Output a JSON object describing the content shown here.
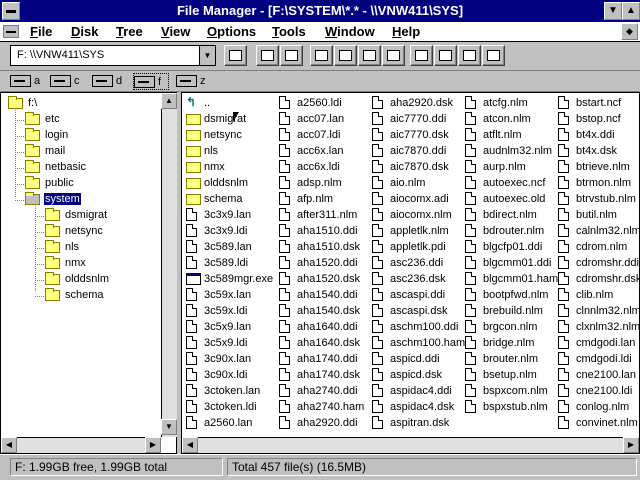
{
  "window": {
    "title": "File Manager - [F:\\SYSTEM\\*.* - \\\\VNW411\\SYS]"
  },
  "menubar": {
    "items": [
      "File",
      "Disk",
      "Tree",
      "View",
      "Options",
      "Tools",
      "Window",
      "Help"
    ]
  },
  "toolbar": {
    "drive_select_value": "F: \\\\VNW411\\SYS"
  },
  "drives": [
    {
      "letter": "a",
      "selected": false
    },
    {
      "letter": "c",
      "selected": false
    },
    {
      "letter": "d",
      "selected": false
    },
    {
      "letter": "f",
      "selected": true
    },
    {
      "letter": "z",
      "selected": false
    }
  ],
  "tree": {
    "root": "f:\\",
    "nodes": [
      {
        "label": "etc",
        "level": 1
      },
      {
        "label": "login",
        "level": 1
      },
      {
        "label": "mail",
        "level": 1
      },
      {
        "label": "netbasic",
        "level": 1
      },
      {
        "label": "public",
        "level": 1
      },
      {
        "label": "system",
        "level": 1,
        "selected": true
      },
      {
        "label": "dsmigrat",
        "level": 2
      },
      {
        "label": "netsync",
        "level": 2
      },
      {
        "label": "nls",
        "level": 2
      },
      {
        "label": "nmx",
        "level": 2
      },
      {
        "label": "olddsnlm",
        "level": 2
      },
      {
        "label": "schema",
        "level": 2
      }
    ]
  },
  "files": {
    "columns": [
      [
        {
          "name": "..",
          "icon": "up"
        },
        {
          "name": "dsmigrat",
          "icon": "folder"
        },
        {
          "name": "netsync",
          "icon": "folder"
        },
        {
          "name": "nls",
          "icon": "folder"
        },
        {
          "name": "nmx",
          "icon": "folder"
        },
        {
          "name": "olddsnlm",
          "icon": "folder"
        },
        {
          "name": "schema",
          "icon": "folder"
        },
        {
          "name": "3c3x9.lan",
          "icon": "doc"
        },
        {
          "name": "3c3x9.ldi",
          "icon": "doc"
        },
        {
          "name": "3c589.lan",
          "icon": "doc"
        },
        {
          "name": "3c589.ldi",
          "icon": "doc"
        },
        {
          "name": "3c589mgr.exe",
          "icon": "exe"
        },
        {
          "name": "3c59x.lan",
          "icon": "doc"
        },
        {
          "name": "3c59x.ldi",
          "icon": "doc"
        },
        {
          "name": "3c5x9.lan",
          "icon": "doc"
        },
        {
          "name": "3c5x9.ldi",
          "icon": "doc"
        },
        {
          "name": "3c90x.lan",
          "icon": "doc"
        },
        {
          "name": "3c90x.ldi",
          "icon": "doc"
        },
        {
          "name": "3ctoken.lan",
          "icon": "doc"
        },
        {
          "name": "3ctoken.ldi",
          "icon": "doc"
        },
        {
          "name": "a2560.lan",
          "icon": "doc"
        }
      ],
      [
        {
          "name": "a2560.ldi",
          "icon": "doc"
        },
        {
          "name": "acc07.lan",
          "icon": "doc"
        },
        {
          "name": "acc07.ldi",
          "icon": "doc"
        },
        {
          "name": "acc6x.lan",
          "icon": "doc"
        },
        {
          "name": "acc6x.ldi",
          "icon": "doc"
        },
        {
          "name": "adsp.nlm",
          "icon": "doc"
        },
        {
          "name": "afp.nlm",
          "icon": "doc"
        },
        {
          "name": "after311.nlm",
          "icon": "doc"
        },
        {
          "name": "aha1510.ddi",
          "icon": "doc"
        },
        {
          "name": "aha1510.dsk",
          "icon": "doc"
        },
        {
          "name": "aha1520.ddi",
          "icon": "doc"
        },
        {
          "name": "aha1520.dsk",
          "icon": "doc"
        },
        {
          "name": "aha1540.ddi",
          "icon": "doc"
        },
        {
          "name": "aha1540.dsk",
          "icon": "doc"
        },
        {
          "name": "aha1640.ddi",
          "icon": "doc"
        },
        {
          "name": "aha1640.dsk",
          "icon": "doc"
        },
        {
          "name": "aha1740.ddi",
          "icon": "doc"
        },
        {
          "name": "aha1740.dsk",
          "icon": "doc"
        },
        {
          "name": "aha2740.ddi",
          "icon": "doc"
        },
        {
          "name": "aha2740.ham",
          "icon": "doc"
        },
        {
          "name": "aha2920.ddi",
          "icon": "doc"
        }
      ],
      [
        {
          "name": "aha2920.dsk",
          "icon": "doc"
        },
        {
          "name": "aic7770.ddi",
          "icon": "doc"
        },
        {
          "name": "aic7770.dsk",
          "icon": "doc"
        },
        {
          "name": "aic7870.ddi",
          "icon": "doc"
        },
        {
          "name": "aic7870.dsk",
          "icon": "doc"
        },
        {
          "name": "aio.nlm",
          "icon": "doc"
        },
        {
          "name": "aiocomx.adi",
          "icon": "doc"
        },
        {
          "name": "aiocomx.nlm",
          "icon": "doc"
        },
        {
          "name": "appletlk.nlm",
          "icon": "doc"
        },
        {
          "name": "appletlk.pdi",
          "icon": "doc"
        },
        {
          "name": "asc236.ddi",
          "icon": "doc"
        },
        {
          "name": "asc236.dsk",
          "icon": "doc"
        },
        {
          "name": "ascaspi.ddi",
          "icon": "doc"
        },
        {
          "name": "ascaspi.dsk",
          "icon": "doc"
        },
        {
          "name": "aschm100.ddi",
          "icon": "doc"
        },
        {
          "name": "aschm100.ham",
          "icon": "doc"
        },
        {
          "name": "aspicd.ddi",
          "icon": "doc"
        },
        {
          "name": "aspicd.dsk",
          "icon": "doc"
        },
        {
          "name": "aspidac4.ddi",
          "icon": "doc"
        },
        {
          "name": "aspidac4.dsk",
          "icon": "doc"
        },
        {
          "name": "aspitran.dsk",
          "icon": "doc"
        }
      ],
      [
        {
          "name": "atcfg.nlm",
          "icon": "doc"
        },
        {
          "name": "atcon.nlm",
          "icon": "doc"
        },
        {
          "name": "atflt.nlm",
          "icon": "doc"
        },
        {
          "name": "audnlm32.nlm",
          "icon": "doc"
        },
        {
          "name": "aurp.nlm",
          "icon": "doc"
        },
        {
          "name": "autoexec.ncf",
          "icon": "doc"
        },
        {
          "name": "autoexec.old",
          "icon": "doc"
        },
        {
          "name": "bdirect.nlm",
          "icon": "doc"
        },
        {
          "name": "bdrouter.nlm",
          "icon": "doc"
        },
        {
          "name": "blgcfp01.ddi",
          "icon": "doc"
        },
        {
          "name": "blgcmm01.ddi",
          "icon": "doc"
        },
        {
          "name": "blgcmm01.ham",
          "icon": "doc"
        },
        {
          "name": "bootpfwd.nlm",
          "icon": "doc"
        },
        {
          "name": "brebuild.nlm",
          "icon": "doc"
        },
        {
          "name": "brgcon.nlm",
          "icon": "doc"
        },
        {
          "name": "bridge.nlm",
          "icon": "doc"
        },
        {
          "name": "brouter.nlm",
          "icon": "doc"
        },
        {
          "name": "bsetup.nlm",
          "icon": "doc"
        },
        {
          "name": "bspxcom.nlm",
          "icon": "doc"
        },
        {
          "name": "bspxstub.nlm",
          "icon": "doc"
        }
      ],
      [
        {
          "name": "bstart.ncf",
          "icon": "doc"
        },
        {
          "name": "bstop.ncf",
          "icon": "doc"
        },
        {
          "name": "bt4x.ddi",
          "icon": "doc"
        },
        {
          "name": "bt4x.dsk",
          "icon": "doc"
        },
        {
          "name": "btrieve.nlm",
          "icon": "doc"
        },
        {
          "name": "btrmon.nlm",
          "icon": "doc"
        },
        {
          "name": "btrvstub.nlm",
          "icon": "doc"
        },
        {
          "name": "butil.nlm",
          "icon": "doc"
        },
        {
          "name": "calnlm32.nlm",
          "icon": "doc"
        },
        {
          "name": "cdrom.nlm",
          "icon": "doc"
        },
        {
          "name": "cdromshr.ddi",
          "icon": "doc"
        },
        {
          "name": "cdromshr.dsk",
          "icon": "doc"
        },
        {
          "name": "clib.nlm",
          "icon": "doc"
        },
        {
          "name": "clnnlm32.nlm",
          "icon": "doc"
        },
        {
          "name": "clxnlm32.nlm",
          "icon": "doc"
        },
        {
          "name": "cmdgodi.lan",
          "icon": "doc"
        },
        {
          "name": "cmdgodi.ldi",
          "icon": "doc"
        },
        {
          "name": "cne2100.lan",
          "icon": "doc"
        },
        {
          "name": "cne2100.ldi",
          "icon": "doc"
        },
        {
          "name": "conlog.nlm",
          "icon": "doc"
        },
        {
          "name": "convinet.nlm",
          "icon": "doc"
        }
      ]
    ]
  },
  "status": {
    "free_space": "F: 1.99GB free,  1.99GB total",
    "total_files": "Total 457 file(s) (16.5MB)"
  }
}
